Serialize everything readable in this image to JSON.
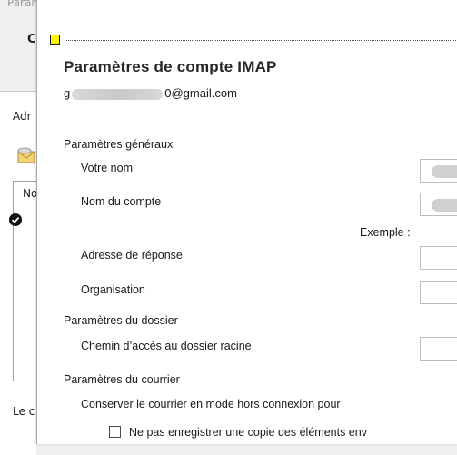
{
  "background_window": {
    "title_fragment": "Paran",
    "heading_fragment": "C",
    "tab_fragment": "Adr",
    "list_header_fragment": "No",
    "bottom_text_fragment": "Le c"
  },
  "dialog": {
    "title": "Paramètres de compte IMAP",
    "email_suffix": "@gmail.com",
    "email_prefix_visible": "g",
    "email_mid_visible": "0",
    "sections": {
      "general": "Paramètres généraux",
      "folder": "Paramètres du dossier",
      "mail": "Paramètres du courrier"
    },
    "fields": {
      "your_name_label": "Votre nom",
      "account_name_label": "Nom du compte",
      "example_text": "Exemple :",
      "reply_address_label": "Adresse de réponse",
      "organization_label": "Organisation",
      "root_folder_label": "Chemin d’accès au dossier racine"
    },
    "offline_label": "Conserver le courrier en mode hors connexion pour",
    "checkbox_label": "Ne pas enregistrer une copie des éléments env"
  }
}
